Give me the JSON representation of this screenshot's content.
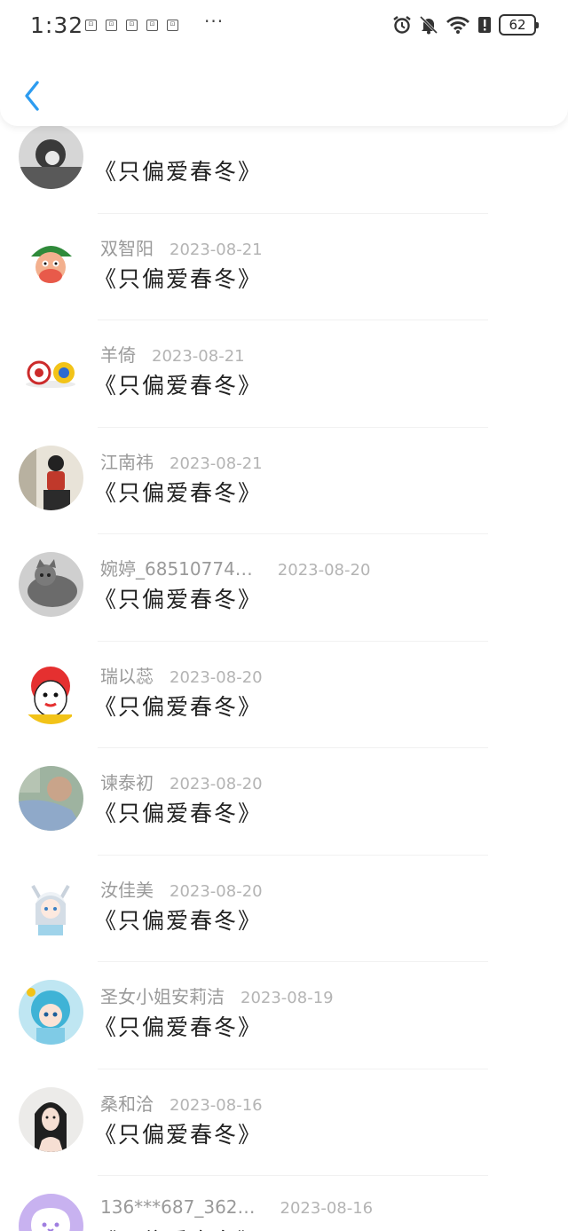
{
  "status_bar": {
    "time": "1:32",
    "notifications": [
      "app-notification-icon",
      "app-notification-icon",
      "app-notification-icon",
      "app-notification-icon",
      "app-notification-icon"
    ],
    "more": "···",
    "battery": "62"
  },
  "header": {
    "back_icon": "chevron-left-icon",
    "accent": "#2d9cf0"
  },
  "comments": [
    {
      "name": "",
      "date": "",
      "title": "《只偏爱春冬》",
      "avatar": "grayscale-photo"
    },
    {
      "name": "双智阳",
      "date": "2023-08-21",
      "title": "《只偏爱春冬》",
      "avatar": "cartoon-character"
    },
    {
      "name": "羊倚",
      "date": "2023-08-21",
      "title": "《只偏爱春冬》",
      "avatar": "two-balls"
    },
    {
      "name": "江南祎",
      "date": "2023-08-21",
      "title": "《只偏爱春冬》",
      "avatar": "anime-boy"
    },
    {
      "name": "婉婷_68510774…",
      "date": "2023-08-20",
      "title": "《只偏爱春冬》",
      "avatar": "tabby-cat"
    },
    {
      "name": "瑞以蕊",
      "date": "2023-08-20",
      "title": "《只偏爱春冬》",
      "avatar": "clown-chick"
    },
    {
      "name": "谏泰初",
      "date": "2023-08-20",
      "title": "《只偏爱春冬》",
      "avatar": "photo-person"
    },
    {
      "name": "汝佳美",
      "date": "2023-08-20",
      "title": "《只偏爱春冬》",
      "avatar": "anime-catgirl"
    },
    {
      "name": "圣女小姐安莉洁",
      "date": "2023-08-19",
      "title": "《只偏爱春冬》",
      "avatar": "anime-bluehair"
    },
    {
      "name": "桑和洽",
      "date": "2023-08-16",
      "title": "《只偏爱春冬》",
      "avatar": "portrait-girl"
    },
    {
      "name": "136***687_362…",
      "date": "2023-08-16",
      "title": "《只偏爱春冬》",
      "avatar": "default-chat-bubble"
    }
  ]
}
